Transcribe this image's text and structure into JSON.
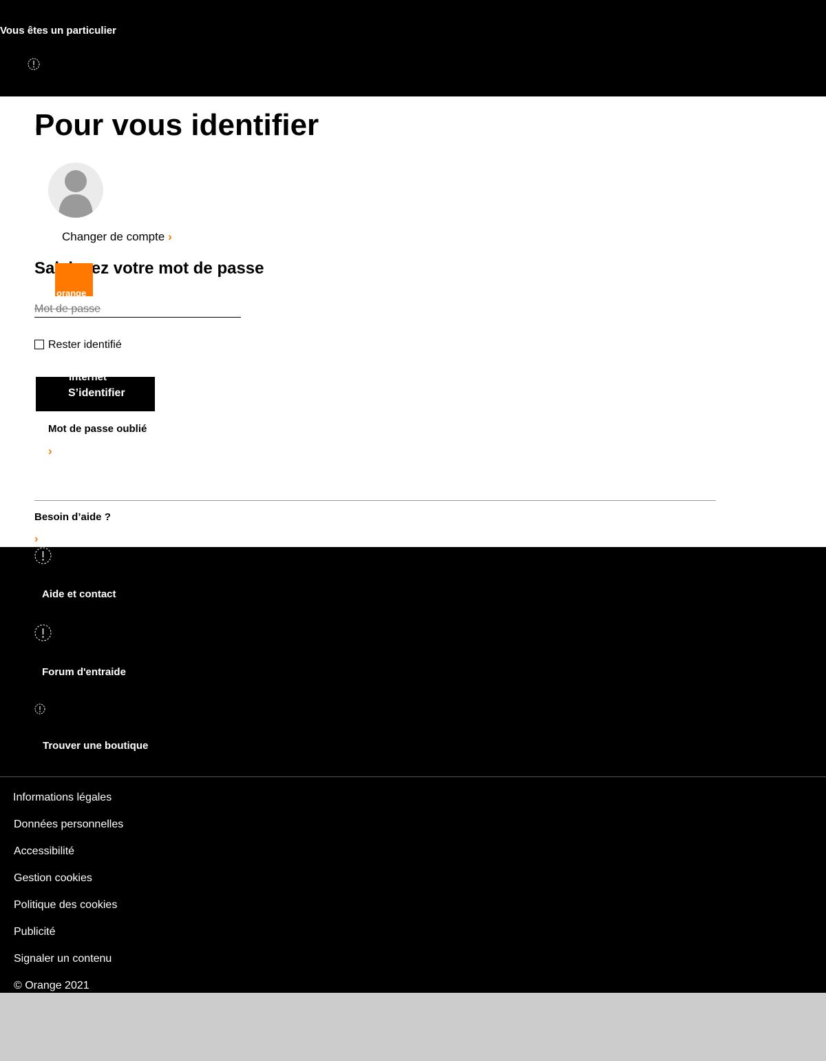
{
  "header": {
    "title": "Vous êtes un particulier",
    "icon": "info-circle-icon"
  },
  "main": {
    "title": "Pour vous identifier",
    "stray_glyph": "i",
    "avatar_icon": "user-avatar-icon",
    "switch_account": "Changer de compte",
    "password_heading": "Saisissez votre mot de passe",
    "logo_text": "orange",
    "password_placeholder": "Mot de passe",
    "remember_label": "Rester identifié",
    "submit_overlap_text": "internet",
    "submit_label": "S’identifier",
    "forgot_password": "Mot de passe oublié",
    "help_heading": "Besoin d’aide ?",
    "chevron": "›"
  },
  "help_links": [
    {
      "label": "Aide et contact",
      "icon": "info-circle-icon"
    },
    {
      "label": "Forum d'entraide",
      "icon": "info-circle-icon"
    },
    {
      "label": "Trouver une boutique",
      "icon": "info-circle-icon"
    }
  ],
  "footer": {
    "links": [
      "Informations légales",
      "Données personnelles",
      "Accessibilité",
      "Gestion cookies",
      "Politique des cookies",
      "Publicité",
      "Signaler un contenu"
    ],
    "copyright": "© Orange 2021"
  },
  "colors": {
    "brand_orange": "#ff7900",
    "header_bg": "#000000",
    "page_bg": "#ffffff",
    "bottom_bg": "#cccccc"
  }
}
